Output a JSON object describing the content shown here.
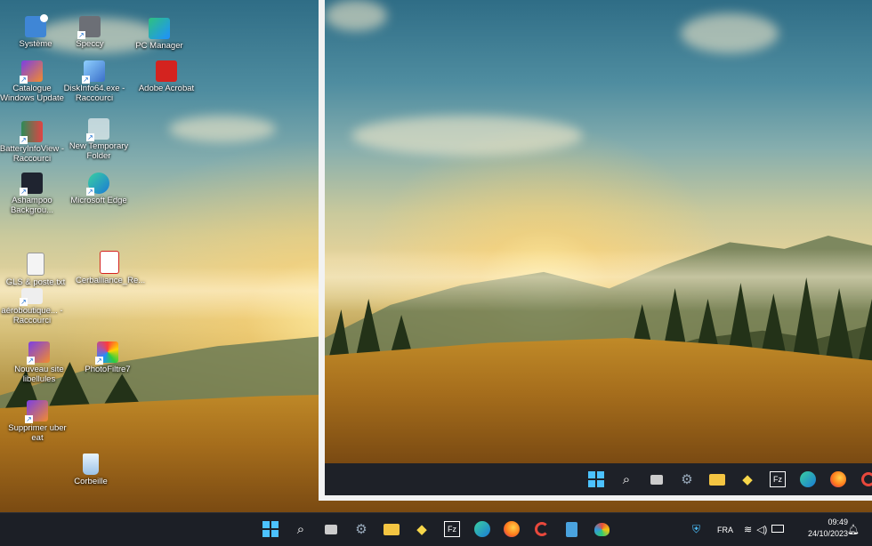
{
  "desktop": {
    "icons": [
      {
        "label": "Système",
        "icon": "system-icon"
      },
      {
        "label": "Speccy",
        "icon": "speccy-icon"
      },
      {
        "label": "PC Manager",
        "icon": "pc-manager-icon"
      },
      {
        "label": "Catalogue Windows Update",
        "icon": "windows-update-catalog-icon"
      },
      {
        "label": "DiskInfo64.exe - Raccourci",
        "icon": "diskinfo-icon"
      },
      {
        "label": "Adobe Acrobat",
        "icon": "adobe-acrobat-icon"
      },
      {
        "label": "BatteryInfoView - Raccourci",
        "icon": "batteryinfoview-icon"
      },
      {
        "label": "New Temporary Folder",
        "icon": "folder-icon"
      },
      {
        "label": "Ashampoo Backgrou...",
        "icon": "ashampoo-icon"
      },
      {
        "label": "Microsoft Edge",
        "icon": "edge-icon"
      },
      {
        "label": "GLS & poste.txt",
        "icon": "text-file-icon"
      },
      {
        "label": "Cerballiance_Re...",
        "icon": "pdf-file-icon"
      },
      {
        "label": "aéroboutique... - Raccourci",
        "icon": "shortcut-icon"
      },
      {
        "label": "Nouveau site libellules",
        "icon": "site-shortcut-icon"
      },
      {
        "label": "PhotoFiltre7",
        "icon": "photofiltre-icon"
      },
      {
        "label": "Supprimer uber eat",
        "icon": "shortcut-icon"
      },
      {
        "label": "Corbeille",
        "icon": "recycle-bin-icon"
      }
    ]
  },
  "taskbar": {
    "apps": [
      "start-icon",
      "search-icon",
      "task-view-icon",
      "settings-icon",
      "file-explorer-icon",
      "sticky-app-icon",
      "fz-app-icon",
      "edge-icon",
      "firefox-icon",
      "ccleaner-icon",
      "notepad-icon",
      "paint-icon"
    ],
    "language": "FRA",
    "time": "09:49",
    "date": "24/10/2023"
  },
  "snapped_window": {
    "taskbar_apps": [
      "start-icon",
      "search-icon",
      "task-view-icon",
      "settings-icon",
      "file-explorer-icon",
      "sticky-app-icon",
      "fz-app-icon",
      "edge-icon",
      "firefox-icon",
      "ccleaner-icon"
    ]
  },
  "colors": {
    "taskbar_bg": "#1c1f26",
    "accent_blue": "#1e90ff"
  }
}
